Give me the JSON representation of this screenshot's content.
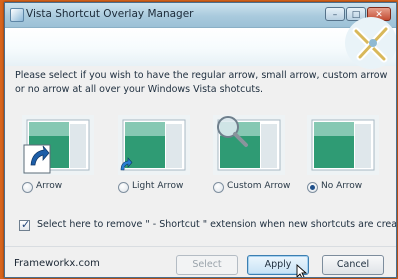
{
  "window": {
    "title": "Vista Shortcut Overlay Manager",
    "controls": {
      "minimize": "–",
      "maximize": "□",
      "close": "✕"
    }
  },
  "instructions": "Please select if you wish to have the regular arrow, small arrow, custom arrow or no arrow at all over your Windows Vista shotcuts.",
  "options": [
    {
      "label": "Arrow",
      "checked": false,
      "overlay": "large-arrow-icon"
    },
    {
      "label": "Light Arrow",
      "checked": false,
      "overlay": "small-arrow-icon"
    },
    {
      "label": "Custom Arrow",
      "checked": false,
      "overlay": "magnifier-icon"
    },
    {
      "label": "No Arrow",
      "checked": true,
      "overlay": "none"
    }
  ],
  "remove_extension": {
    "label": "Select here to remove \" - Shortcut \" extension when new shortcuts are created.",
    "checked": true
  },
  "footer": {
    "brand": "Frameworkx.com",
    "select_label": "Select",
    "apply_label": "Apply",
    "cancel_label": "Cancel"
  },
  "colors": {
    "accent": "#3c7fb1",
    "frame": "#d8641c",
    "preview_green": "#2f9b74"
  }
}
